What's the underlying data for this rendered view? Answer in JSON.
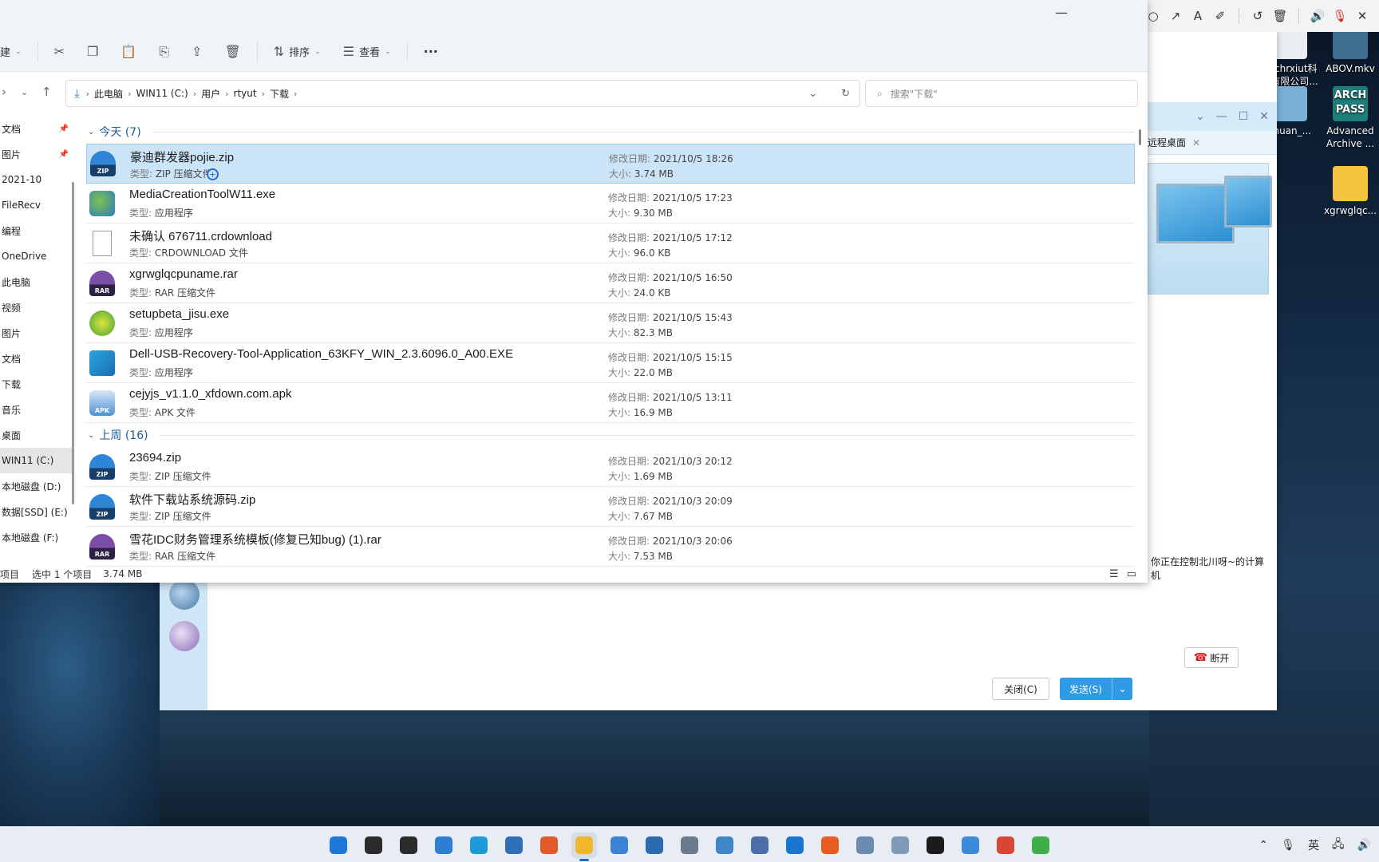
{
  "explorer": {
    "toolbar": {
      "new_label": "建",
      "sort_label": "排序",
      "view_label": "查看",
      "more_label": "···"
    },
    "address": {
      "crumbs": [
        "此电脑",
        "WIN11 (C:)",
        "用户",
        "rtyut",
        "下载"
      ]
    },
    "search": {
      "placeholder": "搜索\"下载\""
    },
    "nav": [
      {
        "label": "文档",
        "pinned": true
      },
      {
        "label": "图片",
        "pinned": true
      },
      {
        "label": "2021-10",
        "pinned": false
      },
      {
        "label": "FileRecv",
        "pinned": false
      },
      {
        "label": "编程",
        "pinned": false
      },
      {
        "label": "OneDrive",
        "pinned": false
      },
      {
        "label": "此电脑",
        "pinned": false
      },
      {
        "label": "视频",
        "pinned": false
      },
      {
        "label": "图片",
        "pinned": false
      },
      {
        "label": "文档",
        "pinned": false
      },
      {
        "label": "下载",
        "pinned": false
      },
      {
        "label": "音乐",
        "pinned": false
      },
      {
        "label": "桌面",
        "pinned": false
      },
      {
        "label": "WIN11 (C:)",
        "pinned": false,
        "selected": true
      },
      {
        "label": "本地磁盘 (D:)",
        "pinned": false
      },
      {
        "label": "数据[SSD] (E:)",
        "pinned": false
      },
      {
        "label": "本地磁盘 (F:)",
        "pinned": false
      }
    ],
    "labels": {
      "modified": "修改日期:",
      "size": "大小:",
      "type": "类型:"
    },
    "groups": [
      {
        "title": "今天 (7)",
        "files": [
          {
            "name": "豪迪群发器pojie.zip",
            "type": "ZIP 压缩文件",
            "date": "2021/10/5 18:26",
            "size": "3.74 MB",
            "icon": "zip",
            "icon_text": "ZIP",
            "selected": true
          },
          {
            "name": "MediaCreationToolW11.exe",
            "type": "应用程序",
            "date": "2021/10/5 17:23",
            "size": "9.30 MB",
            "icon": "exe",
            "icon_text": ""
          },
          {
            "name": "未确认 676711.crdownload",
            "type": "CRDOWNLOAD 文件",
            "date": "2021/10/5 17:12",
            "size": "96.0 KB",
            "icon": "doc",
            "icon_text": ""
          },
          {
            "name": "xgrwglqcpuname.rar",
            "type": "RAR 压缩文件",
            "date": "2021/10/5 16:50",
            "size": "24.0 KB",
            "icon": "rar",
            "icon_text": "RAR"
          },
          {
            "name": "setupbeta_jisu.exe",
            "type": "应用程序",
            "date": "2021/10/5 15:43",
            "size": "82.3 MB",
            "icon": "app",
            "icon_text": ""
          },
          {
            "name": "Dell-USB-Recovery-Tool-Application_63KFY_WIN_2.3.6096.0_A00.EXE",
            "type": "应用程序",
            "date": "2021/10/5 15:15",
            "size": "22.0 MB",
            "icon": "dell",
            "icon_text": ""
          },
          {
            "name": "cejyjs_v1.1.0_xfdown.com.apk",
            "type": "APK 文件",
            "date": "2021/10/5 13:11",
            "size": "16.9 MB",
            "icon": "apk",
            "icon_text": "APK"
          }
        ]
      },
      {
        "title": "上周 (16)",
        "files": [
          {
            "name": "23694.zip",
            "type": "ZIP 压缩文件",
            "date": "2021/10/3 20:12",
            "size": "1.69 MB",
            "icon": "zip",
            "icon_text": "ZIP"
          },
          {
            "name": "软件下载站系统源码.zip",
            "type": "ZIP 压缩文件",
            "date": "2021/10/3 20:09",
            "size": "7.67 MB",
            "icon": "zip",
            "icon_text": "ZIP"
          },
          {
            "name": "雪花IDC财务管理系统模板(修复已知bug) (1).rar",
            "type": "RAR 压缩文件",
            "date": "2021/10/3 20:06",
            "size": "7.53 MB",
            "icon": "rar",
            "icon_text": "RAR"
          }
        ]
      }
    ],
    "status": {
      "items": "项目",
      "selected": "选中 1 个项目",
      "size": "3.74 MB"
    }
  },
  "desktop_icons": [
    {
      "label": "lurchrxiut科\n技有限公司...",
      "color": "#e9eef3"
    },
    {
      "label": "ABOV.mkv",
      "color": "#3c6e8f"
    },
    {
      "label": "chuan_...",
      "color": "#7ab0d6"
    },
    {
      "label": "Advanced\nArchive ...",
      "color": "#1f7d7a",
      "badge": "ARCH\nPASS"
    },
    {
      "label": "xgrwglqc...",
      "color": "#f2c440"
    }
  ],
  "chat": {
    "close_label": "关闭(C)",
    "send_label": "发送(S)"
  },
  "remote": {
    "tab_label": "远程桌面",
    "message": "你正在控制北川呀~的计算机",
    "disconnect_label": "断开"
  },
  "taskbar": {
    "apps": [
      {
        "name": "start",
        "color": "#1e78d7"
      },
      {
        "name": "search",
        "color": "#2b2b2b"
      },
      {
        "name": "task-view",
        "color": "#2b2b2b"
      },
      {
        "name": "widgets",
        "color": "#2d7fd4"
      },
      {
        "name": "edge",
        "color": "#1c9bd8"
      },
      {
        "name": "store",
        "color": "#2f6fb7"
      },
      {
        "name": "office",
        "color": "#e35a2a"
      },
      {
        "name": "file-explorer",
        "color": "#f0b72a",
        "active": true
      },
      {
        "name": "app-blue",
        "color": "#3b82d6"
      },
      {
        "name": "video",
        "color": "#2d6bb0"
      },
      {
        "name": "settings",
        "color": "#6b7a8a"
      },
      {
        "name": "remote",
        "color": "#3f86c9"
      },
      {
        "name": "paint",
        "color": "#4d6fa8"
      },
      {
        "name": "arrow",
        "color": "#1a75cf"
      },
      {
        "name": "orange",
        "color": "#e85c24"
      },
      {
        "name": "network",
        "color": "#6a8ab0"
      },
      {
        "name": "photos",
        "color": "#7f9ab7"
      },
      {
        "name": "steam",
        "color": "#1b1b1b"
      },
      {
        "name": "box",
        "color": "#3a8cd6"
      },
      {
        "name": "chrome",
        "color": "#d94636"
      },
      {
        "name": "n-app",
        "color": "#3fae49"
      }
    ],
    "tray": {
      "input_lang": "英"
    }
  }
}
